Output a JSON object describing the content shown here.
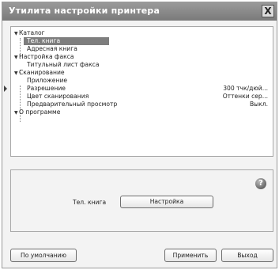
{
  "window": {
    "title": "Утилита настройки принтера",
    "close_label": "X"
  },
  "tree": {
    "items": [
      {
        "label": "Каталог",
        "expanded": true,
        "value": ""
      },
      {
        "label": "Тел. книга",
        "selected": true,
        "value": ""
      },
      {
        "label": "Адресная книга",
        "value": ""
      },
      {
        "label": "Настройка факса",
        "expanded": true,
        "value": ""
      },
      {
        "label": "Титульный лист факса",
        "value": ""
      },
      {
        "label": "Сканирование",
        "expanded": true,
        "value": ""
      },
      {
        "label": "Приложение",
        "value": ""
      },
      {
        "label": "Разрешение",
        "value": "300 тчк/дюй..."
      },
      {
        "label": "Цвет сканирования",
        "value": "Оттенки сер..."
      },
      {
        "label": "Предварительный просмотр",
        "value": "Выкл."
      },
      {
        "label": "О программе",
        "expanded": true,
        "value": ""
      }
    ]
  },
  "panel": {
    "label": "Тел. книга",
    "settings_button": "Настройка",
    "help_glyph": "?"
  },
  "footer": {
    "default_button": "По умолчанию",
    "apply_button": "Применить",
    "exit_button": "Выход"
  },
  "icons": [
    "close-icon",
    "expand-arrow-icon",
    "help-icon",
    "side-arrow-icon"
  ]
}
